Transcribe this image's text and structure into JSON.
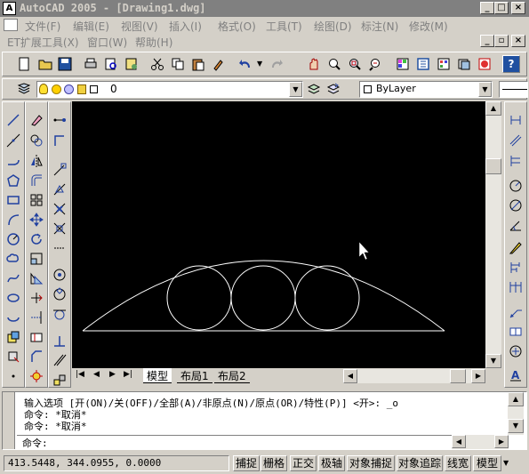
{
  "titlebar": {
    "title": "AutoCAD 2005 - [Drawing1.dwg]",
    "minimize": "_",
    "maximize": "□",
    "close": "×"
  },
  "menubar": {
    "row1": [
      "文件(F)",
      "编辑(E)",
      "视图(V)",
      "插入(I)",
      "格式(O)",
      "工具(T)",
      "绘图(D)",
      "标注(N)",
      "修改(M)"
    ],
    "row2": [
      "ET扩展工具(X)",
      "窗口(W)",
      "帮助(H)"
    ]
  },
  "layer_bar": {
    "layer_value": "0",
    "color_value": "ByLayer"
  },
  "layout_tabs": [
    "模型",
    "布局1",
    "布局2"
  ],
  "command": {
    "line1": "输入选项 [开(ON)/关(OFF)/全部(A)/非原点(N)/原点(OR)/特性(P)] <开>: _o",
    "line2": "命令: *取消*",
    "line3": "命令: *取消*",
    "prompt": "命令:"
  },
  "status": {
    "coords": "413.5448, 344.0955, 0.0000",
    "buttons": [
      "捕捉",
      "栅格",
      "正交",
      "极轴",
      "对象捕捉",
      "对象追踪",
      "线宽",
      "模型"
    ]
  },
  "colors": {
    "title_bg": "#808080",
    "canvas_bg": "#000000",
    "drawing_stroke": "#ffffff",
    "face": "#d4d0c8"
  }
}
